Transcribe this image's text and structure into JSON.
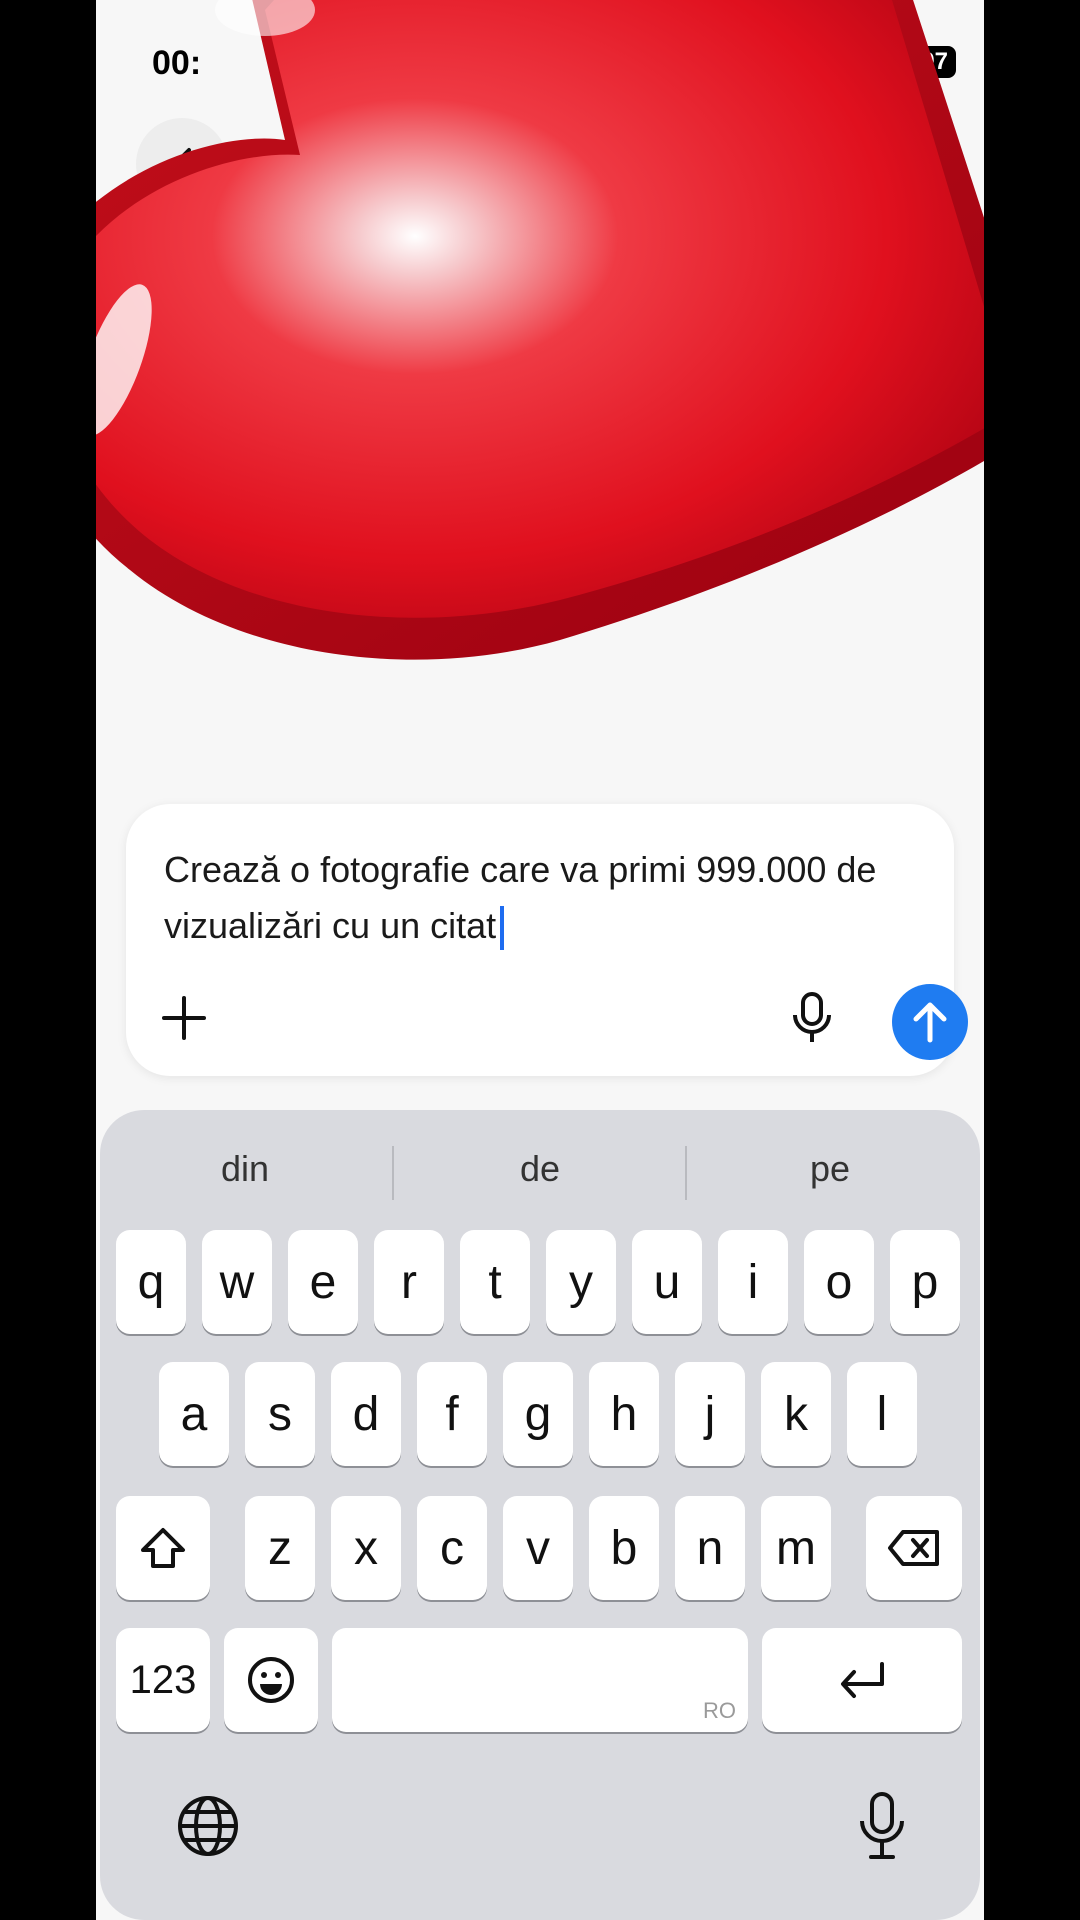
{
  "status": {
    "time": "00:",
    "battery": "97"
  },
  "composer": {
    "text": "Crează o fotografie care va primi 999.000 de vizualizări cu un citat"
  },
  "suggestions": [
    "din",
    "de",
    "pe"
  ],
  "keyboard": {
    "row1": [
      "q",
      "w",
      "e",
      "r",
      "t",
      "y",
      "u",
      "i",
      "o",
      "p"
    ],
    "row2": [
      "a",
      "s",
      "d",
      "f",
      "g",
      "h",
      "j",
      "k",
      "l"
    ],
    "row3": [
      "z",
      "x",
      "c",
      "v",
      "b",
      "n",
      "m"
    ],
    "numbers_key": "123",
    "space_language": "RO"
  },
  "colors": {
    "accent": "#1f7cf1",
    "heart": "#e0202a"
  },
  "icons": [
    "back-icon",
    "wifi-icon",
    "heart-sticker",
    "plus-icon",
    "microphone-icon",
    "send-arrow-icon",
    "shift-icon",
    "backspace-icon",
    "emoji-icon",
    "return-icon",
    "globe-icon",
    "dictation-icon"
  ]
}
